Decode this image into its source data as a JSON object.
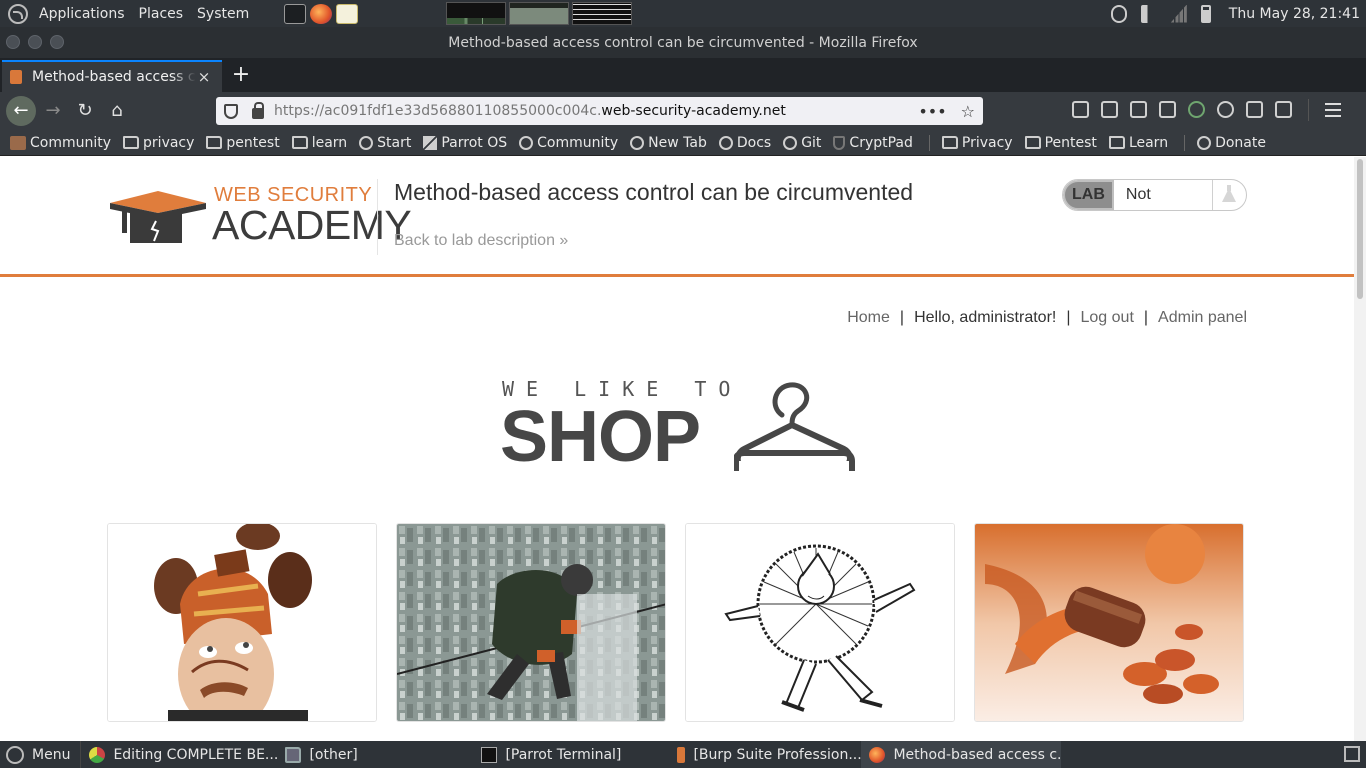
{
  "desktop": {
    "menus": [
      "Applications",
      "Places",
      "System"
    ],
    "clock": "Thu May 28, 21:41"
  },
  "window": {
    "title": "Method-based access control can be circumvented - Mozilla Firefox"
  },
  "browser": {
    "tab_title": "Method-based access control can be circumvented",
    "tab_close": "×",
    "new_tab": "+",
    "url_prefix": "https://ac091fdf1e33d56880110855000c004c.",
    "url_host": "web-security-academy.net",
    "url_more": "•••",
    "url_star": "☆",
    "bookmarks": [
      {
        "label": "Community",
        "icon": "community-icon"
      },
      {
        "label": "privacy",
        "icon": "folder-icon"
      },
      {
        "label": "pentest",
        "icon": "folder-icon"
      },
      {
        "label": "learn",
        "icon": "folder-icon"
      },
      {
        "label": "Start",
        "icon": "globe-icon"
      },
      {
        "label": "Parrot OS",
        "icon": "parrot-icon"
      },
      {
        "label": "Community",
        "icon": "globe-icon"
      },
      {
        "label": "New Tab",
        "icon": "globe-icon"
      },
      {
        "label": "Docs",
        "icon": "globe-icon"
      },
      {
        "label": "Git",
        "icon": "globe-icon"
      },
      {
        "label": "CryptPad",
        "icon": "shield-icon"
      },
      {
        "label": "Privacy",
        "icon": "folder-icon"
      },
      {
        "label": "Pentest",
        "icon": "folder-icon"
      },
      {
        "label": "Learn",
        "icon": "folder-icon"
      },
      {
        "label": "Donate",
        "icon": "globe-icon"
      }
    ]
  },
  "academy": {
    "logo_top": "WEB SECURITY",
    "logo_bottom": "ACADEMY",
    "lab_title": "Method-based access control can be circumvented",
    "back_link": "Back to lab description »",
    "lab_badge": "LAB",
    "lab_state": "Not solved"
  },
  "shop": {
    "nav": {
      "home": "Home",
      "greeting": "Hello, administrator!",
      "logout": "Log out",
      "admin": "Admin panel",
      "separator": "|"
    },
    "tagline_small": "WE LIKE TO",
    "tagline_big": "SHOP",
    "accent_color": "#e07d3c"
  },
  "taskbar": {
    "menu_label": "Menu",
    "tasks": [
      {
        "label": "Editing COMPLETE BE...",
        "icon": "chrome-icon"
      },
      {
        "label": "[other]",
        "icon": "folder-icon"
      },
      {
        "label": "[Parrot Terminal]",
        "icon": "terminal-icon"
      },
      {
        "label": "[Burp Suite Profession...",
        "icon": "burp-icon"
      },
      {
        "label": "Method-based access c...",
        "icon": "firefox-icon"
      }
    ]
  }
}
